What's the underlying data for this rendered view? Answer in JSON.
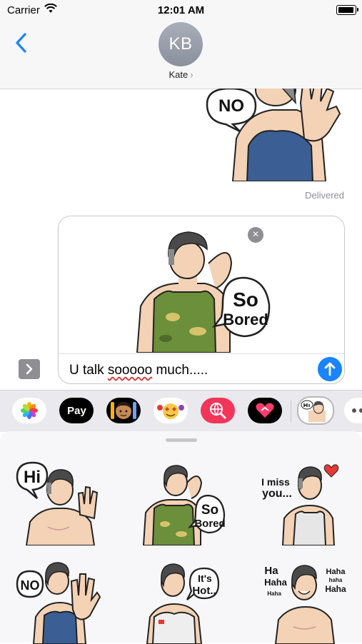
{
  "status_bar": {
    "carrier": "Carrier",
    "time": "12:01 AM",
    "battery_level": 0.95
  },
  "header": {
    "avatar_initials": "KB",
    "contact_name": "Kate",
    "contact_chevron": "›"
  },
  "conversation": {
    "sent_sticker_text": "NO",
    "status": "Delivered"
  },
  "compose": {
    "sticker_text_line1": "So",
    "sticker_text_line2": "Bored",
    "remove_glyph": "×",
    "message_before": "U talk ",
    "message_misspelled": "sooooo",
    "message_after": " much....."
  },
  "app_strip": {
    "apple_pay_label": "Pay",
    "apple_glyph": ""
  },
  "sticker_drawer": {
    "stickers": [
      {
        "name": "hi",
        "lines": [
          "Hi"
        ]
      },
      {
        "name": "so-bored",
        "lines": [
          "So",
          "Bored"
        ]
      },
      {
        "name": "i-miss-you",
        "lines": [
          "I miss",
          "you..."
        ]
      },
      {
        "name": "no",
        "lines": [
          "NO"
        ]
      },
      {
        "name": "its-hot",
        "lines": [
          "It's",
          "Hot.."
        ]
      },
      {
        "name": "haha",
        "lines": [
          "Ha",
          "Haha",
          "Haha",
          "haha",
          "Haha",
          "Haha"
        ]
      }
    ]
  },
  "colors": {
    "accent": "#1a84ff",
    "tank_blue": "#3b5f94",
    "camo_green": "#6b8f3a",
    "skin": "#f4d2b5",
    "hair": "#4a4a4a",
    "heart": "#e53935"
  }
}
